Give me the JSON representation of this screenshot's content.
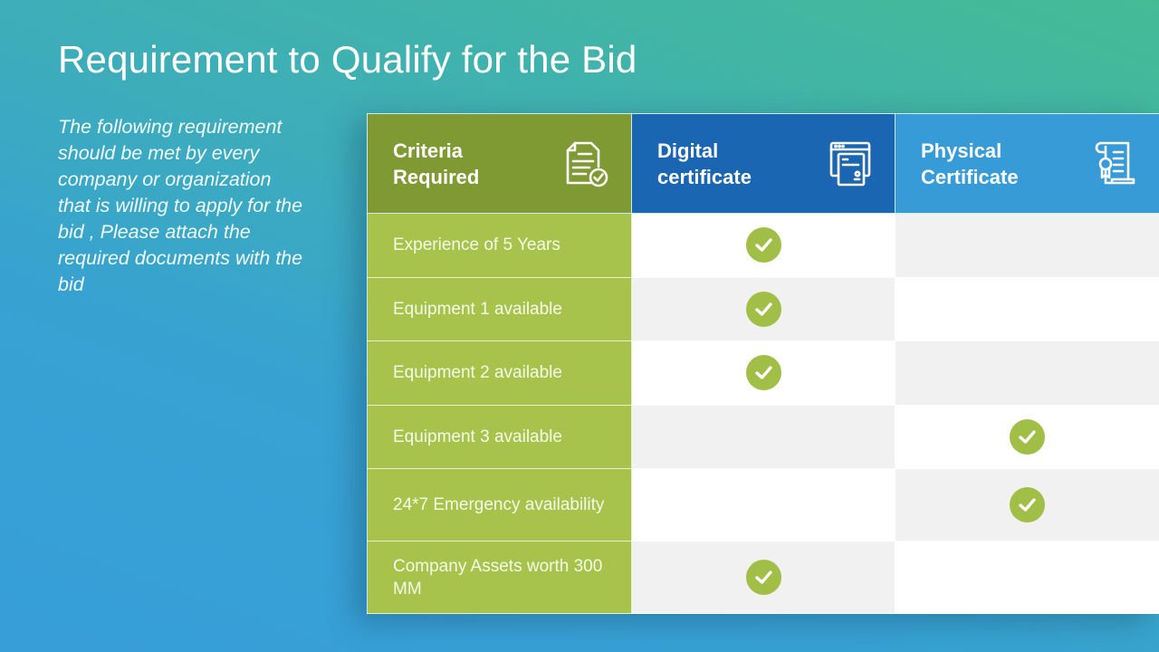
{
  "title": "Requirement to Qualify for the Bid",
  "intro": "The following requirement should be met by every company or organization that is willing to apply for the bid , Please attach the required documents with the bid",
  "colors": {
    "criteria_header": "#7f9a33",
    "criteria_cell": "#a8c34c",
    "digital_header": "#1b66b3",
    "physical_header": "#379bd8",
    "check": "#a1bf46"
  },
  "table": {
    "headers": [
      {
        "label": "Criteria Required",
        "icon": "document-check-icon"
      },
      {
        "label": "Digital certificate",
        "icon": "browser-document-icon"
      },
      {
        "label": "Physical Certificate",
        "icon": "scroll-certificate-icon"
      }
    ],
    "rows": [
      {
        "criteria": "Experience of 5 Years",
        "digital": true,
        "physical": false
      },
      {
        "criteria": "Equipment 1 available",
        "digital": true,
        "physical": false
      },
      {
        "criteria": "Equipment 2 available",
        "digital": true,
        "physical": false
      },
      {
        "criteria": "Equipment 3 available",
        "digital": false,
        "physical": true
      },
      {
        "criteria": "24*7 Emergency availability",
        "digital": false,
        "physical": true
      },
      {
        "criteria": "Company Assets worth 300 MM",
        "digital": true,
        "physical": false
      }
    ]
  }
}
